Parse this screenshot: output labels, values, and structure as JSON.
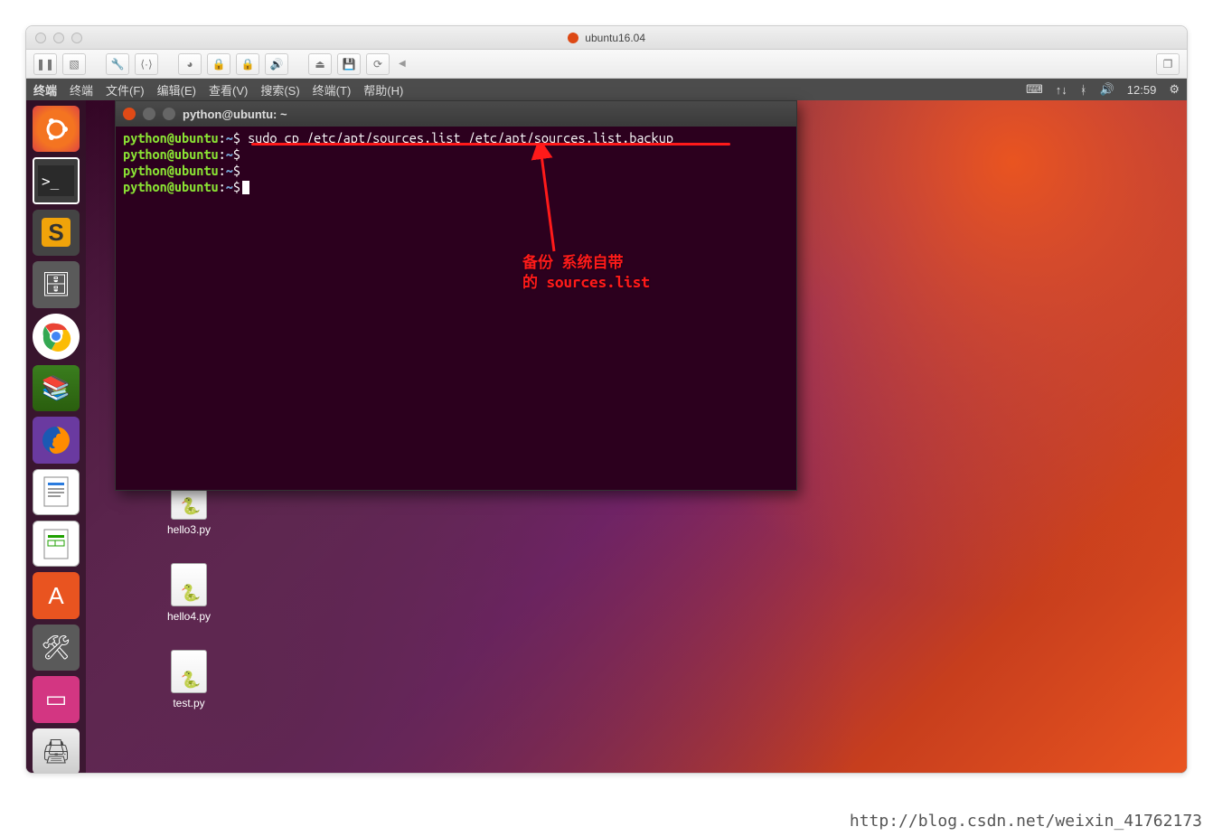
{
  "host_window": {
    "title": "ubuntu16.04"
  },
  "ubuntu_menubar": {
    "app": "终端",
    "items": [
      "终端",
      "文件(F)",
      "编辑(E)",
      "查看(V)",
      "搜索(S)",
      "终端(T)",
      "帮助(H)"
    ]
  },
  "indicators": {
    "time": "12:59"
  },
  "terminal": {
    "title": "python@ubuntu: ~",
    "prompt_user": "python@ubuntu",
    "prompt_sep": ":",
    "prompt_path": "~",
    "prompt_dollar": "$",
    "command": "sudo cp /etc/apt/sources.list /etc/apt/sources.list.backup"
  },
  "desktop": {
    "files": [
      "hello3.py",
      "hello4.py",
      "test.py"
    ]
  },
  "annotation": {
    "line1": "备份 系统自带",
    "line2": "的 sources.list"
  },
  "watermark": "http://blog.csdn.net/weixin_41762173"
}
